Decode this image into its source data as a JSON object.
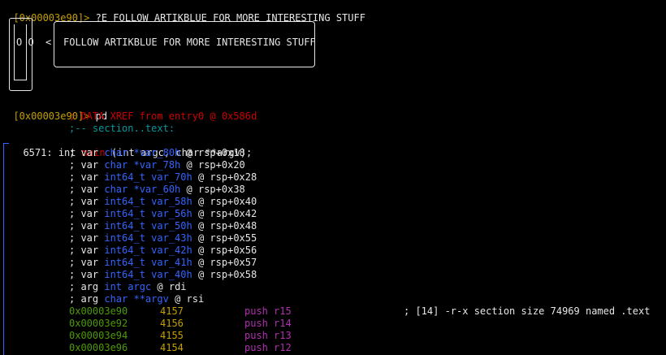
{
  "prompt1": "[0x00003e90]>",
  "command1": "?E FOLLOW ARTIKBLUE FOR MORE INTERESTING STUFF",
  "clippy": {
    "eyes": "O O",
    "arrow": "<",
    "message": "FOLLOW ARTIKBLUE FOR MORE INTERESTING STUFF"
  },
  "prompt2": "[0x00003e90]>",
  "command2": "pd",
  "xref_comment": "; DATA XREF from entry0 @ 0x586d",
  "section_comment": ";-- section..text:",
  "func": {
    "size": "6571:",
    "type": "int",
    "name": "main",
    "signature": "(int argc, char **argv);"
  },
  "vars": [
    {
      "kind": "; var",
      "type": "char *var_80h",
      "loc": "@ rsp+0x18"
    },
    {
      "kind": "; var",
      "type": "char *var_78h",
      "loc": "@ rsp+0x20"
    },
    {
      "kind": "; var",
      "type": "int64_t var_70h",
      "loc": "@ rsp+0x28"
    },
    {
      "kind": "; var",
      "type": "char *var_60h",
      "loc": "@ rsp+0x38"
    },
    {
      "kind": "; var",
      "type": "int64_t var_58h",
      "loc": "@ rsp+0x40"
    },
    {
      "kind": "; var",
      "type": "int64_t var_56h",
      "loc": "@ rsp+0x42"
    },
    {
      "kind": "; var",
      "type": "int64_t var_50h",
      "loc": "@ rsp+0x48"
    },
    {
      "kind": "; var",
      "type": "int64_t var_43h",
      "loc": "@ rsp+0x55"
    },
    {
      "kind": "; var",
      "type": "int64_t var_42h",
      "loc": "@ rsp+0x56"
    },
    {
      "kind": "; var",
      "type": "int64_t var_41h",
      "loc": "@ rsp+0x57"
    },
    {
      "kind": "; var",
      "type": "int64_t var_40h",
      "loc": "@ rsp+0x58"
    },
    {
      "kind": "; arg",
      "type": "int argc",
      "loc": "@ rdi"
    },
    {
      "kind": "; arg",
      "type": "char **argv",
      "loc": "@ rsi"
    }
  ],
  "instructions": [
    {
      "addr": "0x00003e90",
      "bytes": "4157",
      "mnem": "push",
      "op": "r15",
      "comment": "; [14] -r-x section size 74969 named .text"
    },
    {
      "addr": "0x00003e92",
      "bytes": "4156",
      "mnem": "push",
      "op": "r14",
      "comment": ""
    },
    {
      "addr": "0x00003e94",
      "bytes": "4155",
      "mnem": "push",
      "op": "r13",
      "comment": ""
    },
    {
      "addr": "0x00003e96",
      "bytes": "4154",
      "mnem": "push",
      "op": "r12",
      "comment": ""
    }
  ],
  "colors": {
    "background": "#000000",
    "text": "#e6e6e6",
    "prompt": "#c4a000",
    "comment_red": "#cc0000",
    "comment_cyan": "#06989a",
    "var_blue": "#3465ff",
    "address_green": "#4e9a06",
    "bytes_orange": "#c4a000",
    "mnemonic_purple": "#b130b1"
  }
}
